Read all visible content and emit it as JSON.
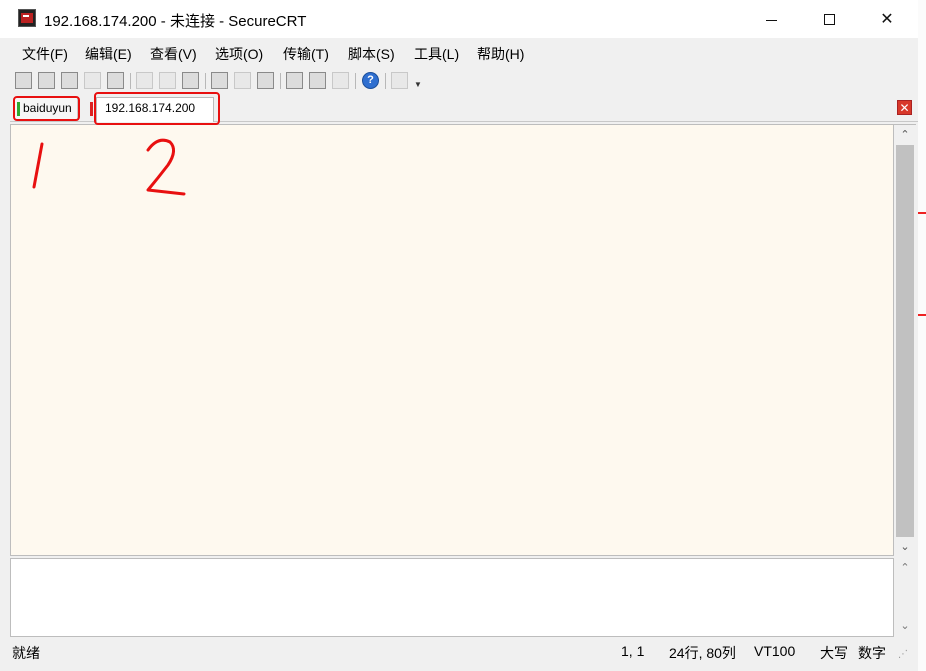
{
  "window": {
    "title": "192.168.174.200 - 未连接 - SecureCRT",
    "controls": {
      "minimize": "minimize-icon",
      "maximize": "maximize-icon",
      "close": "✕"
    }
  },
  "menu": [
    "文件(F)",
    "编辑(E)",
    "查看(V)",
    "选项(O)",
    "传输(T)",
    "脚本(S)",
    "工具(L)",
    "帮助(H)"
  ],
  "toolbar": {
    "icons": [
      "connect-icon",
      "quick-connect-icon",
      "connect-in-tab-icon",
      "reconnect-icon",
      "disconnect-icon",
      "copy-icon",
      "paste-icon",
      "find-icon",
      "print-icon",
      "print-selection-icon",
      "print-setup-icon",
      "session-options-icon",
      "global-options-icon",
      "keymap-icon",
      "help-icon",
      "sftp-icon"
    ],
    "help_glyph": "?"
  },
  "tabs": [
    {
      "label": "baiduyun",
      "status_color": "#2fa82f"
    },
    {
      "label": "192.168.174.200",
      "status_color": "#dd2222",
      "active": true
    }
  ],
  "tab_close_glyph": "✕",
  "annotations": {
    "label_1": "1",
    "label_2": "2",
    "color": "#e81010"
  },
  "status": {
    "left": "就绪",
    "position": "1,  1",
    "size": "24行, 80列",
    "emulation": "VT100",
    "caps": "大写",
    "num": "数字"
  },
  "colors": {
    "terminal_bg": "#fef9ef",
    "chrome": "#f0f0f0",
    "accent": "#e81010"
  }
}
